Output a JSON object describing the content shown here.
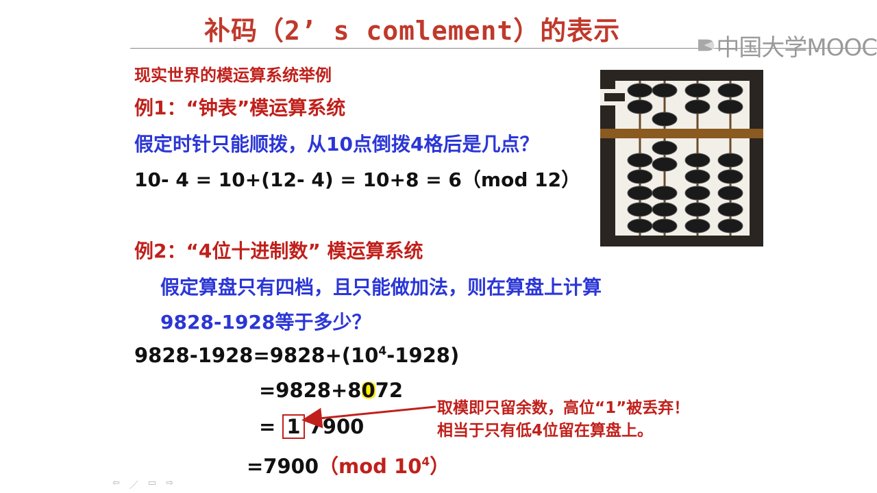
{
  "title": "补码（2’ s comlement）的表示",
  "logo": {
    "text": "中国大学MOOC"
  },
  "section_heading": "现实世界的模运算系统举例",
  "example1": {
    "heading": "例1：“钟表”模运算系统",
    "question": "假定时针只能顺拨，从10点倒拨4格后是几点？",
    "formula": "10- 4 = 10+(12- 4) = 10+8 = 6（mod 12）"
  },
  "example2": {
    "heading": "例2：“4位十进制数” 模运算系统",
    "question_line1": "假定算盘只有四档，且只能做加法，则在算盘上计算",
    "question_line2": "9828-1928等于多少？",
    "step1_main": "9828-1928=9828+(10",
    "step1_exp": "4",
    "step1_tail": "-1928)",
    "step2_a": "=9828+8",
    "step2_b": "0",
    "step2_c": "72",
    "step3_prefix": "= ",
    "step3_box": "1",
    "step3_rest": "7900",
    "step4_main": "=7900",
    "step4_mod_open": "（mod 10",
    "step4_mod_exp": "4",
    "step4_mod_close": "）",
    "note_line1": "取模即只留余数，高位“1”被丢弃！",
    "note_line2": "相当于只有低4位留在算盘上。"
  },
  "nav_icons": [
    "prev-arrow-icon",
    "pen-icon",
    "menu-icon",
    "next-arrow-icon"
  ],
  "colors": {
    "title": "#c0392b",
    "red": "#c0201b",
    "blue": "#2b36d6",
    "text": "#111111",
    "abacus_bead": "#1a1a1a",
    "abacus_frame": "#2a2520",
    "abacus_beam": "#8a5a20"
  }
}
